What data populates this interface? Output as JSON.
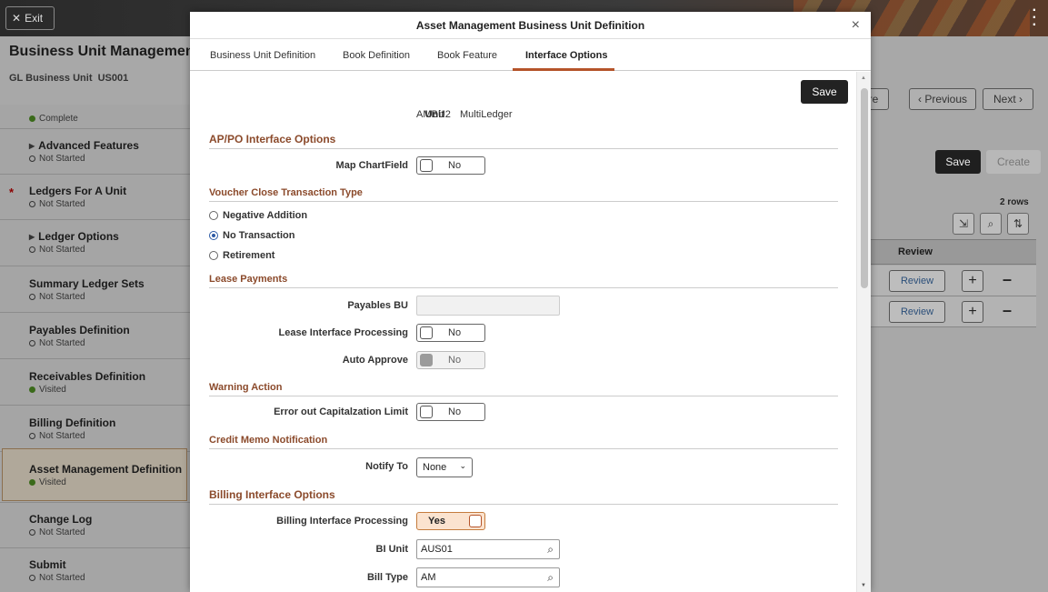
{
  "topbar": {
    "exit_label": "Exit",
    "exit_icon": "close-icon",
    "menu_icon": "kebab-icon"
  },
  "app": {
    "title": "Business Unit Management",
    "gl_unit_label": "GL Business Unit",
    "gl_unit_value": "US001",
    "partial_step_status": "Complete"
  },
  "steps": [
    {
      "title": "Advanced Features",
      "status": "Not Started",
      "expandable": true,
      "required": false
    },
    {
      "title": "Ledgers For A Unit",
      "status": "Not Started",
      "expandable": false,
      "required": true
    },
    {
      "title": "Ledger Options",
      "status": "Not Started",
      "expandable": true,
      "required": false
    },
    {
      "title": "Summary Ledger Sets",
      "status": "Not Started",
      "expandable": false,
      "required": false
    },
    {
      "title": "Payables Definition",
      "status": "Not Started",
      "expandable": false,
      "required": false
    },
    {
      "title": "Receivables Definition",
      "status": "Visited",
      "expandable": false,
      "required": false
    },
    {
      "title": "Billing Definition",
      "status": "Not Started",
      "expandable": false,
      "required": false
    },
    {
      "title": "Asset Management Definition",
      "status": "Visited",
      "expandable": false,
      "required": false
    },
    {
      "title": "Change Log",
      "status": "Not Started",
      "expandable": false,
      "required": false
    },
    {
      "title": "Submit",
      "status": "Not Started",
      "expandable": false,
      "required": false
    }
  ],
  "right_panel": {
    "partial_btn": "re",
    "previous_label": "Previous",
    "next_label": "Next",
    "save_label": "Save",
    "create_label": "Create",
    "rows_count": "2 rows",
    "grid_header": "Review",
    "rows": [
      {
        "review_label": "Review"
      },
      {
        "review_label": "Review"
      }
    ]
  },
  "modal": {
    "title": "Asset Management Business Unit Definition",
    "tabs": [
      "Business Unit Definition",
      "Book Definition",
      "Book Feature",
      "Interface Options"
    ],
    "active_tab": "Interface Options",
    "save_label": "Save",
    "unit_label": "Unit",
    "unit_value": "AMBU2",
    "unit_desc": "MultiLedger",
    "sections": {
      "appo": "AP/PO Interface Options",
      "voucher": "Voucher Close Transaction Type",
      "lease": "Lease Payments",
      "warning": "Warning Action",
      "credit": "Credit Memo Notification",
      "billing": "Billing Interface Options"
    },
    "map_chartfield": {
      "label": "Map ChartField",
      "value": "No"
    },
    "voucher_options": [
      {
        "label": "Negative Addition",
        "selected": false
      },
      {
        "label": "No Transaction",
        "selected": true
      },
      {
        "label": "Retirement",
        "selected": false
      }
    ],
    "payables_bu": {
      "label": "Payables BU",
      "value": ""
    },
    "lease_processing": {
      "label": "Lease Interface Processing",
      "value": "No"
    },
    "auto_approve": {
      "label": "Auto Approve",
      "value": "No"
    },
    "error_cap_limit": {
      "label": "Error out Capitalzation Limit",
      "value": "No"
    },
    "notify_to": {
      "label": "Notify To",
      "value": "None"
    },
    "billing_processing": {
      "label": "Billing Interface Processing",
      "value": "Yes"
    },
    "bi_unit": {
      "label": "BI Unit",
      "value": "AUS01"
    },
    "bill_type": {
      "label": "Bill Type",
      "value": "AM"
    }
  },
  "colors": {
    "accent": "#b5542a",
    "section_text": "#8b4a2b",
    "primary_button": "#222222"
  }
}
